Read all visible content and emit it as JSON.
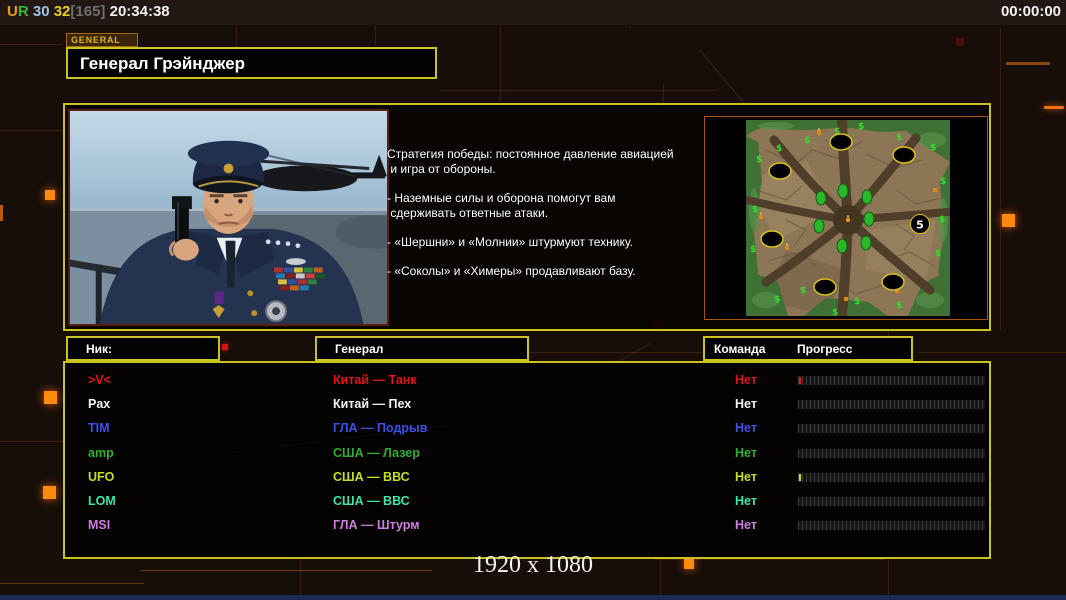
{
  "status_bar": {
    "token_u": "U",
    "token_r": "R",
    "stat_blue": "30",
    "stat_yellow": "32",
    "stat_bracket": "[165]",
    "session_time": "20:34:38",
    "match_time": "00:00:00"
  },
  "header": {
    "tab_label": "GENERAL",
    "title": "Генерал Грэйнджер"
  },
  "briefing": {
    "p1": "Стратегия победы: постоянное давление авиацией\n и игра от обороны.",
    "p2": "- Наземные силы и оборона помогут вам\n сдерживать ответные атаки.",
    "p3": "- «Шершни» и «Молнии» штурмуют технику.",
    "p4": "- «Соколы» и «Химеры» продавливают базу."
  },
  "minimap": {
    "start_badge": "5"
  },
  "roster": {
    "headers": {
      "nick": "Ник:",
      "general": "Генерал",
      "team": "Команда",
      "progress": "Прогресс"
    },
    "rows": [
      {
        "nick": ">V<",
        "general": "Китай — Танк",
        "team": "Нет",
        "color": "#e01414",
        "progress_percent": 1
      },
      {
        "nick": "Pax",
        "general": "Китай — Пех",
        "team": "Нет",
        "color": "#f2f2f2",
        "progress_percent": 0
      },
      {
        "nick": "TIM",
        "general": "ГЛА — Подрыв",
        "team": "Нет",
        "color": "#3b50e6",
        "progress_percent": 0
      },
      {
        "nick": "amp",
        "general": "США — Лазер",
        "team": "Нет",
        "color": "#2fae2f",
        "progress_percent": 0
      },
      {
        "nick": "UFO",
        "general": "США — ВВС",
        "team": "Нет",
        "color": "#c6de20",
        "progress_percent": 1
      },
      {
        "nick": "LOM",
        "general": "США — ВВС",
        "team": "Нет",
        "color": "#3be6a6",
        "progress_percent": 0
      },
      {
        "nick": "MSI",
        "general": "ГЛА — Штурм",
        "team": "Нет",
        "color": "#cf7ce0",
        "progress_percent": 0
      }
    ]
  },
  "footer": {
    "resolution": "1920 x 1080"
  },
  "colors": {
    "panel_border": "#c9c31f",
    "accent_orange": "#ef720e"
  }
}
